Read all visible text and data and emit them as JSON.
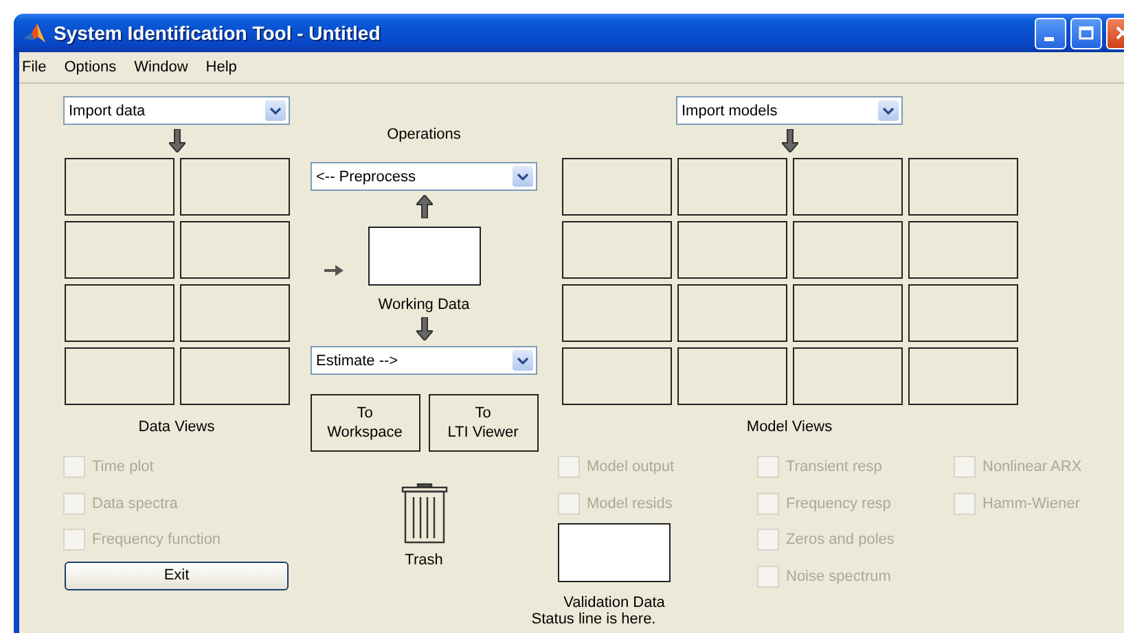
{
  "window": {
    "title": "System Identification Tool - Untitled"
  },
  "menu": [
    "File",
    "Options",
    "Window",
    "Help"
  ],
  "data_panel": {
    "import": "Import data",
    "label": "Data Views",
    "views": [
      {
        "label": "Time plot",
        "checked": false,
        "disabled": true
      },
      {
        "label": "Data spectra",
        "checked": false,
        "disabled": true
      },
      {
        "label": "Frequency function",
        "checked": false,
        "disabled": true
      }
    ],
    "exit_button": "Exit"
  },
  "operations": {
    "title": "Operations",
    "preprocess": "<-- Preprocess",
    "working_data": "Working Data",
    "estimate": "Estimate -->",
    "buttons": [
      "To\nWorkspace",
      "To\nLTI Viewer"
    ],
    "trash": "Trash"
  },
  "model_panel": {
    "import": "Import models",
    "label": "Model Views",
    "view_columns": [
      [
        {
          "label": "Model output",
          "checked": false,
          "disabled": true
        },
        {
          "label": "Model resids",
          "checked": false,
          "disabled": true
        }
      ],
      [
        {
          "label": "Transient resp",
          "checked": false,
          "disabled": true
        },
        {
          "label": "Frequency resp",
          "checked": false,
          "disabled": true
        },
        {
          "label": "Zeros and poles",
          "checked": false,
          "disabled": true
        },
        {
          "label": "Noise spectrum",
          "checked": false,
          "disabled": true
        }
      ],
      [
        {
          "label": "Nonlinear ARX",
          "checked": false,
          "disabled": true
        },
        {
          "label": "Hamm-Wiener",
          "checked": false,
          "disabled": true
        }
      ]
    ],
    "validation_data": "Validation Data"
  },
  "status_line": "Status line is here."
}
